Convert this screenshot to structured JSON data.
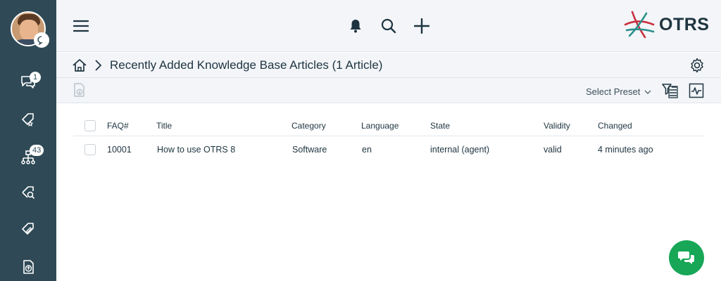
{
  "app": {
    "logo_text": "OTRS"
  },
  "sidebar": {
    "items": [
      {
        "icon": "chat-bubbles-icon",
        "badge": "1"
      },
      {
        "icon": "ticket-star-icon",
        "badge": ""
      },
      {
        "icon": "hierarchy-icon",
        "badge": "43"
      },
      {
        "icon": "ticket-search-icon",
        "badge": ""
      },
      {
        "icon": "ticket-edit-icon",
        "badge": ""
      },
      {
        "icon": "document-upload-icon",
        "badge": ""
      }
    ]
  },
  "header": {
    "icons": [
      "menu-icon",
      "bell-icon",
      "search-icon",
      "plus-icon"
    ]
  },
  "breadcrumb": {
    "title": "Recently Added Knowledge Base Articles (1 Article)"
  },
  "toolbar": {
    "preset_label": "Select Preset"
  },
  "table": {
    "columns": [
      "FAQ#",
      "Title",
      "Category",
      "Language",
      "State",
      "Validity",
      "Changed"
    ],
    "rows": [
      [
        "10001",
        "How to use OTRS 8",
        "Software",
        "en",
        "internal (agent)",
        "valid",
        "4 minutes ago"
      ]
    ]
  },
  "colors": {
    "sidebar_bg": "#2f4a56",
    "header_bg": "#f3f5f8",
    "accent_green": "#17a757",
    "logo_red": "#c8303e",
    "logo_teal": "#2a8f8b"
  }
}
